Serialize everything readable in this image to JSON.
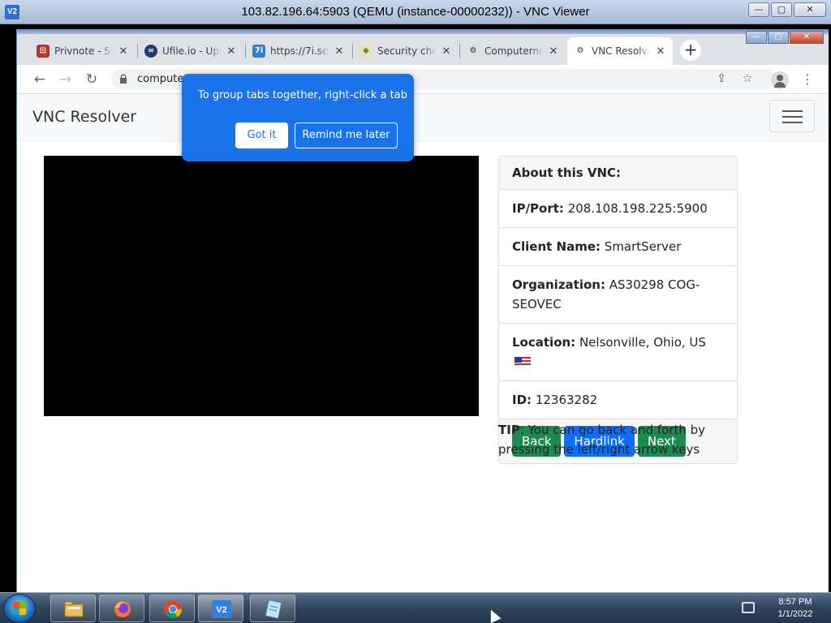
{
  "vnc_window": {
    "title": "103.82.196.64:5903 (QEMU (instance-00000232)) - VNC Viewer",
    "app_icon": "V2",
    "min": "—",
    "max": "▢",
    "close": "✕"
  },
  "chrome": {
    "tabs": [
      {
        "label": "Privnote - Se",
        "icon": "privnote-icon",
        "color": "#b7342b"
      },
      {
        "label": "Ufile.io - Upl",
        "icon": "ufile-icon",
        "color": "#1e3a73"
      },
      {
        "label": "https://7i.se",
        "icon": "7i-icon",
        "color": "#2d7fd2"
      },
      {
        "label": "Security che",
        "icon": "security-check-icon",
        "color": "#6c8b1c"
      },
      {
        "label": "Computerne",
        "icon": "computerne-icon",
        "color": "#555555"
      },
      {
        "label": "VNC Resolve",
        "icon": "vnc-resolver-icon",
        "color": "#555555"
      }
    ],
    "active_tab": 5,
    "new_tab_label": "+",
    "url": "compute",
    "win_min": "—",
    "win_max": "▢",
    "win_close": "✕"
  },
  "tab_group_bubble": {
    "message": "To group tabs together, right-click a tab",
    "got_it": "Got it",
    "remind_later": "Remind me later"
  },
  "page": {
    "brand": "VNC Resolver",
    "card": {
      "header": "About this VNC:",
      "ip_label": "IP/Port:",
      "ip_value": "208.108.198.225:5900",
      "client_label": "Client Name:",
      "client_value": "SmartServer",
      "org_label": "Organization:",
      "org_value": "AS30298 COG-SEOVEC",
      "location_label": "Location:",
      "location_value": "Nelsonville, Ohio, US",
      "id_label": "ID:",
      "id_value": "12363282",
      "buttons": {
        "back": "Back",
        "hardlink": "Hardlink",
        "next": "Next"
      }
    },
    "tip_label": "TIP",
    "tip_text": ": You can go back and forth by pressing the left/right arrow keys"
  },
  "taskbar": {
    "time": "8:57 PM",
    "date": "1/1/2022",
    "items": [
      "explorer-icon",
      "firefox-icon",
      "chrome-icon",
      "vnc-viewer-icon",
      "notepad-icon"
    ]
  },
  "colors": {
    "bubble_blue": "#1a73e8",
    "btn_green": "#1e8a4f",
    "btn_blue": "#0d6efd"
  }
}
